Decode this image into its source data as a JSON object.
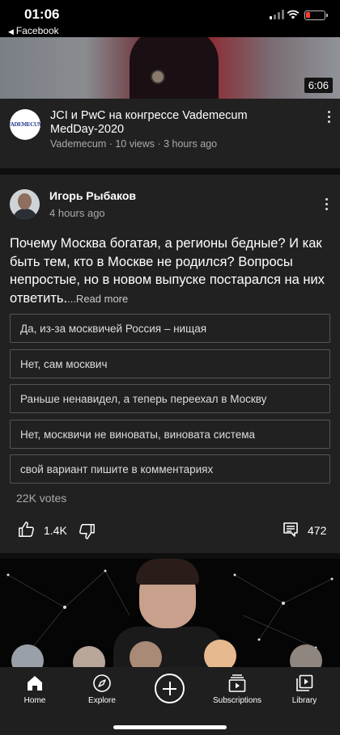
{
  "status_bar": {
    "time": "01:06",
    "back_app": "Facebook",
    "back_arrow": "◀",
    "battery_color": "#ff3b30"
  },
  "video": {
    "duration": "6:06",
    "channel_avatar_text": "VADEMECUM",
    "title": "JCI и PwC на конгрессе Vademecum MedDay-2020",
    "meta": "Vademecum · 10 views · 3 hours ago"
  },
  "post": {
    "author": "Игорь Рыбаков",
    "time": "4 hours ago",
    "text": "Почему Москва богатая, а регионы бедные? И как быть тем, кто в Москве не родился? Вопросы непростые, но в новом выпуске постарался на них ответить.",
    "read_more": "...Read more",
    "poll_options": [
      "Да, из-за москвичей Россия – нищая",
      "Нет, сам москвич",
      "Раньше ненавидел, а теперь переехал в Москву",
      "Нет, москвичи не виноваты, виновата система",
      "свой вариант пишите в комментариях"
    ],
    "votes": "22K votes",
    "likes": "1.4K",
    "comments": "472"
  },
  "tabs": [
    {
      "label": "Home",
      "icon": "home-icon"
    },
    {
      "label": "Explore",
      "icon": "compass-icon"
    },
    {
      "label": "",
      "icon": "create-icon"
    },
    {
      "label": "Subscriptions",
      "icon": "subscriptions-icon"
    },
    {
      "label": "Library",
      "icon": "library-icon"
    }
  ]
}
